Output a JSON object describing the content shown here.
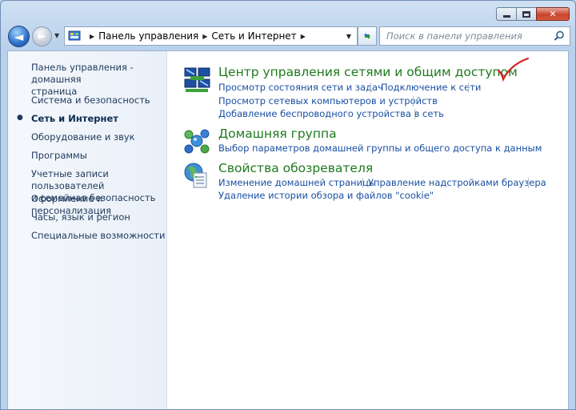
{
  "window": {
    "close_glyph": "✕"
  },
  "nav": {
    "back_glyph": "◄",
    "forward_glyph": "►",
    "breadcrumb": [
      "Панель управления",
      "Сеть и Интернет"
    ],
    "search_placeholder": "Поиск в панели управления"
  },
  "sidebar": {
    "home": [
      "Панель управления - домашняя",
      "страница"
    ],
    "items": [
      "Система и безопасность",
      "Сеть и Интернет",
      "Оборудование и звук",
      "Программы",
      "Учетные записи пользователей",
      "и семейная безопасность",
      "Оформление и персонализация",
      "Часы, язык и регион",
      "Специальные возможности"
    ],
    "active_index": 1
  },
  "categories": [
    {
      "title": "Центр управления сетями и общим доступом",
      "icon": "network-center-icon",
      "links": [
        "Просмотр состояния сети и задач",
        "Подключение к сети",
        "Просмотр сетевых компьютеров и устройств",
        "Добавление беспроводного устройства в сеть"
      ]
    },
    {
      "title": "Домашняя группа",
      "icon": "homegroup-icon",
      "links": [
        "Выбор параметров домашней группы и общего доступа к данным"
      ]
    },
    {
      "title": "Свойства обозревателя",
      "icon": "internet-options-icon",
      "links": [
        "Изменение домашней страницы",
        "Управление надстройками браузера",
        "Удаление истории обзора и файлов \"cookie\""
      ]
    }
  ],
  "colors": {
    "link": "#1a4fa3",
    "category_title": "#1e7a1e",
    "annotation_check": "#d42020"
  }
}
